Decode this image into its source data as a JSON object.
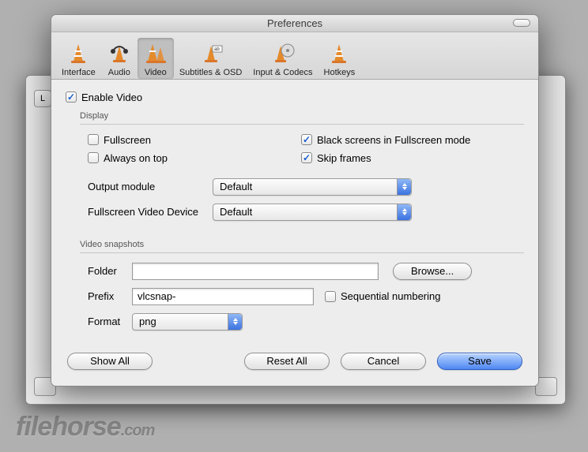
{
  "window": {
    "title": "Preferences"
  },
  "toolbar": {
    "items": [
      {
        "label": "Interface"
      },
      {
        "label": "Audio"
      },
      {
        "label": "Video"
      },
      {
        "label": "Subtitles & OSD"
      },
      {
        "label": "Input & Codecs"
      },
      {
        "label": "Hotkeys"
      }
    ]
  },
  "enable_video_label": "Enable Video",
  "display": {
    "group_label": "Display",
    "fullscreen_label": "Fullscreen",
    "always_on_top_label": "Always on top",
    "black_screens_label": "Black screens in Fullscreen mode",
    "skip_frames_label": "Skip frames",
    "output_module_label": "Output module",
    "output_module_value": "Default",
    "fullscreen_device_label": "Fullscreen Video Device",
    "fullscreen_device_value": "Default"
  },
  "snapshots": {
    "group_label": "Video snapshots",
    "folder_label": "Folder",
    "folder_value": "",
    "browse_label": "Browse...",
    "prefix_label": "Prefix",
    "prefix_value": "vlcsnap-",
    "sequential_label": "Sequential numbering",
    "format_label": "Format",
    "format_value": "png"
  },
  "buttons": {
    "show_all": "Show All",
    "reset_all": "Reset All",
    "cancel": "Cancel",
    "save": "Save"
  },
  "watermark": {
    "brand": "filehorse",
    "suffix": ".com"
  },
  "bg": {
    "tab": "L"
  }
}
